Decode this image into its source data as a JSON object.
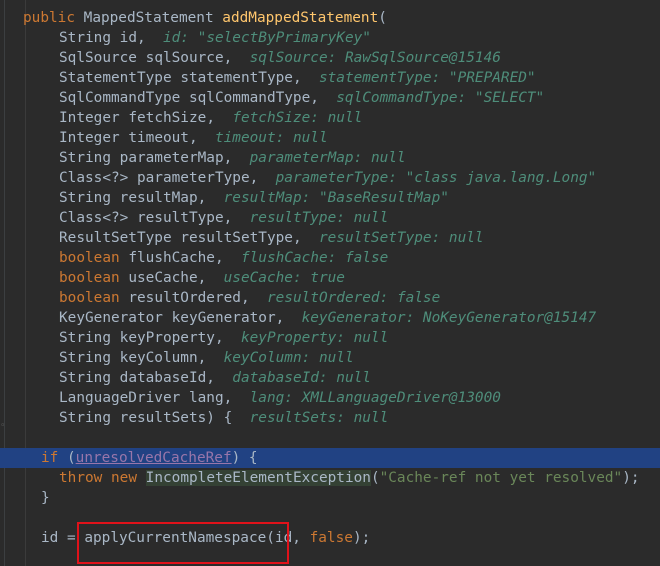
{
  "code": {
    "signature": {
      "modifier": "public",
      "return_type": "MappedStatement",
      "method_name": "addMappedStatement",
      "open_paren": "("
    },
    "params": [
      {
        "type": "String",
        "name": "id",
        "sep": ",",
        "hint_label": "id:",
        "hint_value": "\"selectByPrimaryKey\"",
        "keyword_type": false
      },
      {
        "type": "SqlSource",
        "name": "sqlSource",
        "sep": ",",
        "hint_label": "sqlSource:",
        "hint_value": "RawSqlSource@15146",
        "keyword_type": false
      },
      {
        "type": "StatementType",
        "name": "statementType",
        "sep": ",",
        "hint_label": "statementType:",
        "hint_value": "\"PREPARED\"",
        "keyword_type": false
      },
      {
        "type": "SqlCommandType",
        "name": "sqlCommandType",
        "sep": ",",
        "hint_label": "sqlCommandType:",
        "hint_value": "\"SELECT\"",
        "keyword_type": false
      },
      {
        "type": "Integer",
        "name": "fetchSize",
        "sep": ",",
        "hint_label": "fetchSize:",
        "hint_value": "null",
        "keyword_type": false
      },
      {
        "type": "Integer",
        "name": "timeout",
        "sep": ",",
        "hint_label": "timeout:",
        "hint_value": "null",
        "keyword_type": false
      },
      {
        "type": "String",
        "name": "parameterMap",
        "sep": ",",
        "hint_label": "parameterMap:",
        "hint_value": "null",
        "keyword_type": false
      },
      {
        "type": "Class<?>",
        "name": "parameterType",
        "sep": ",",
        "hint_label": "parameterType:",
        "hint_value": "\"class java.lang.Long\"",
        "keyword_type": false
      },
      {
        "type": "String",
        "name": "resultMap",
        "sep": ",",
        "hint_label": "resultMap:",
        "hint_value": "\"BaseResultMap\"",
        "keyword_type": false
      },
      {
        "type": "Class<?>",
        "name": "resultType",
        "sep": ",",
        "hint_label": "resultType:",
        "hint_value": "null",
        "keyword_type": false
      },
      {
        "type": "ResultSetType",
        "name": "resultSetType",
        "sep": ",",
        "hint_label": "resultSetType:",
        "hint_value": "null",
        "keyword_type": false
      },
      {
        "type": "boolean",
        "name": "flushCache",
        "sep": ",",
        "hint_label": "flushCache:",
        "hint_value": "false",
        "keyword_type": true
      },
      {
        "type": "boolean",
        "name": "useCache",
        "sep": ",",
        "hint_label": "useCache:",
        "hint_value": "true",
        "keyword_type": true
      },
      {
        "type": "boolean",
        "name": "resultOrdered",
        "sep": ",",
        "hint_label": "resultOrdered:",
        "hint_value": "false",
        "keyword_type": true
      },
      {
        "type": "KeyGenerator",
        "name": "keyGenerator",
        "sep": ",",
        "hint_label": "keyGenerator:",
        "hint_value": "NoKeyGenerator@15147",
        "keyword_type": false
      },
      {
        "type": "String",
        "name": "keyProperty",
        "sep": ",",
        "hint_label": "keyProperty:",
        "hint_value": "null",
        "keyword_type": false
      },
      {
        "type": "String",
        "name": "keyColumn",
        "sep": ",",
        "hint_label": "keyColumn:",
        "hint_value": "null",
        "keyword_type": false
      },
      {
        "type": "String",
        "name": "databaseId",
        "sep": ",",
        "hint_label": "databaseId:",
        "hint_value": "null",
        "keyword_type": false
      },
      {
        "type": "LanguageDriver",
        "name": "lang",
        "sep": ",",
        "hint_label": "lang:",
        "hint_value": "XMLLanguageDriver@13000",
        "keyword_type": false
      },
      {
        "type": "String",
        "name": "resultSets",
        "sep": ") {",
        "hint_label": "resultSets:",
        "hint_value": "null",
        "keyword_type": false
      }
    ],
    "if_line": {
      "kw": "if",
      "open": " (",
      "field": "unresolvedCacheRef",
      "close": ") {"
    },
    "throw_line": {
      "kw_throw": "throw",
      "kw_new": "new",
      "exception": "IncompleteElementException",
      "open": "(",
      "message": "\"Cache-ref not yet resolved\"",
      "close": ");"
    },
    "close_brace": "}",
    "assign_line": {
      "lhs": "id = ",
      "call": "applyCurrentNamespace",
      "args_a": "(id, ",
      "arg_lit": "false",
      "args_b": ");"
    }
  }
}
